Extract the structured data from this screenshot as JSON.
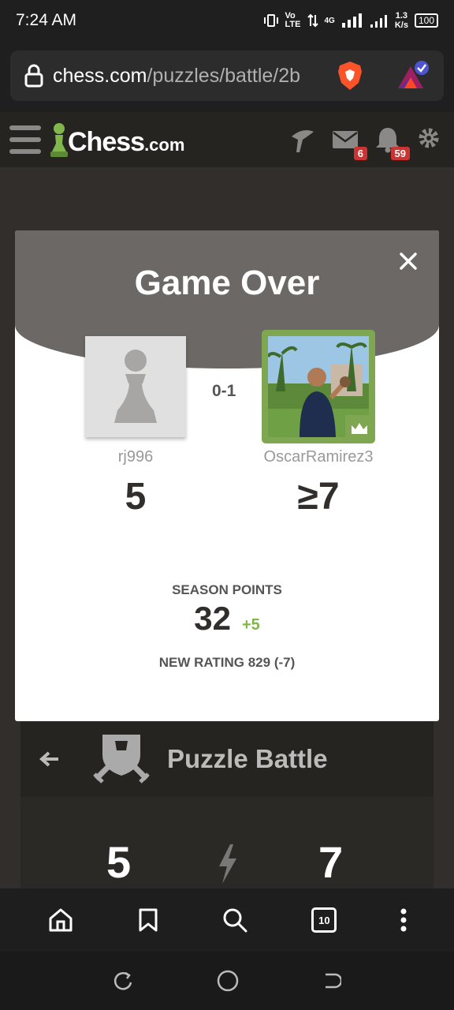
{
  "status": {
    "time": "7:24 AM",
    "network": "Vo LTE",
    "signal": "4G",
    "speed_value": "1.3",
    "speed_unit": "K/s",
    "battery": "100"
  },
  "browser": {
    "url_host": "chess.com",
    "url_path": "/puzzles/battle/2b"
  },
  "header": {
    "logo_text": "Chess",
    "logo_suffix": ".com",
    "messages_badge": "6",
    "notifications_badge": "59"
  },
  "modal": {
    "title": "Game Over",
    "result": "0-1",
    "player_left": {
      "name": "rj996",
      "score": "5"
    },
    "player_right": {
      "name": "OscarRamirez3",
      "score": "≥7"
    },
    "season_label": "SEASON POINTS",
    "season_value": "32",
    "season_delta": "+5",
    "new_rating": "NEW RATING 829 (-7)"
  },
  "battle": {
    "title": "Puzzle Battle",
    "score_left": "5",
    "score_right": "7"
  },
  "browser_nav": {
    "tabs_count": "10"
  },
  "colors": {
    "accent_green": "#81b64c",
    "badge_red": "#c33",
    "modal_header": "#6b6865"
  }
}
